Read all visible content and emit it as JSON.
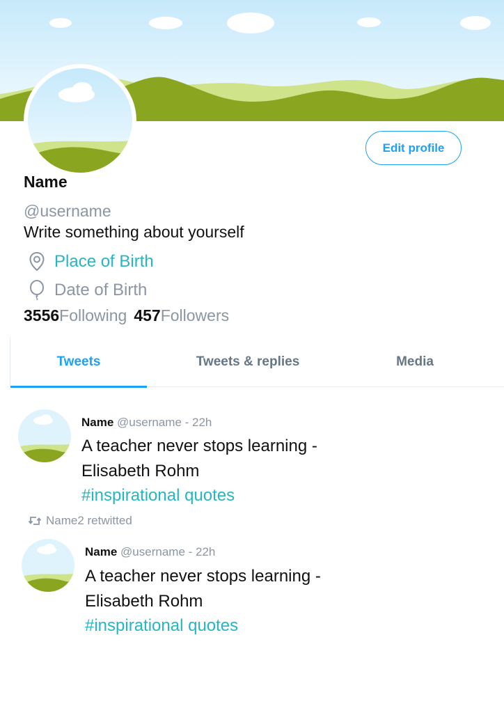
{
  "profile": {
    "name": "Name",
    "handle": "@username",
    "bio": "Write something about yourself",
    "place_of_birth": "Place of Birth",
    "date_of_birth": "Date of Birth",
    "following_count": "3556",
    "following_label": "Following",
    "followers_count": "457",
    "followers_label": "Followers",
    "edit_label": "Edit profile"
  },
  "tabs": [
    {
      "label": "Tweets",
      "active": true
    },
    {
      "label": "Tweets & replies",
      "active": false
    },
    {
      "label": "Media",
      "active": false
    }
  ],
  "tweets": [
    {
      "name": "Name",
      "handle_time": "@username - 22h",
      "line1": "A teacher never stops learning -",
      "line2": "Elisabeth Rohm",
      "hashtag": "#inspirational quotes"
    },
    {
      "retweeted_by": "Name2 retwitted",
      "name": "Name",
      "handle_time": "@username - 22h",
      "line1": "A teacher never stops learning -",
      "line2": "Elisabeth Rohm",
      "hashtag": "#inspirational quotes"
    }
  ],
  "colors": {
    "accent": "#1da1f2",
    "link": "#26b6c0",
    "muted": "#8a96a3",
    "grass": "#8aa51f"
  },
  "icons": [
    "location-pin-icon",
    "balloon-icon",
    "retweet-icon"
  ]
}
